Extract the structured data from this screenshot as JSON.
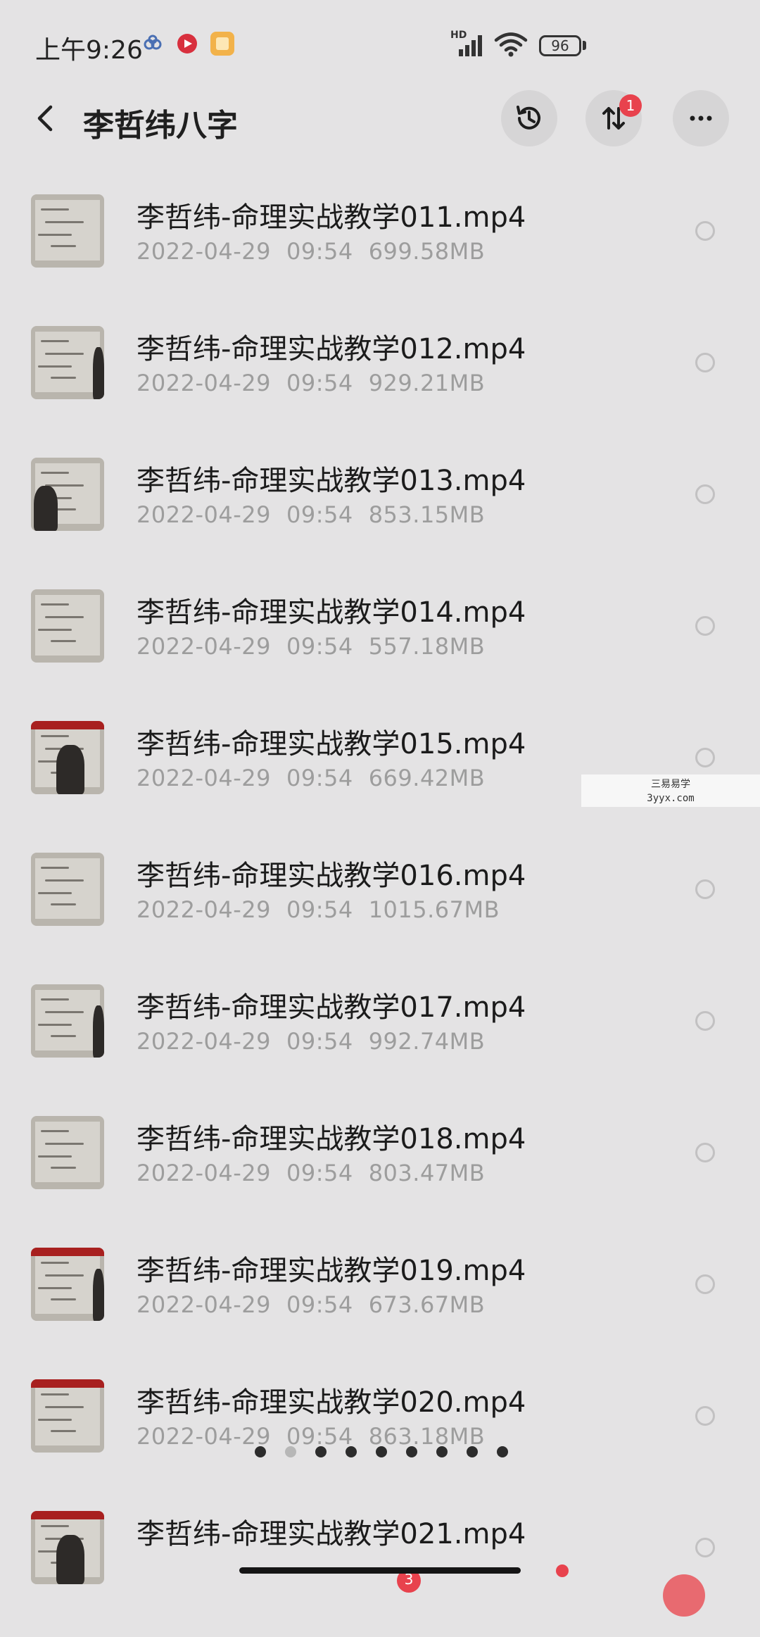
{
  "status_bar": {
    "time": "上午9:26",
    "network_label": "HD",
    "battery": "96"
  },
  "header": {
    "title": "李哲纬八字",
    "transfer_badge": "1"
  },
  "files": [
    {
      "name": "李哲纬-命理实战教学011.mp4",
      "date": "2022-04-29",
      "time": "09:54",
      "size": "699.58MB",
      "thumb": "board"
    },
    {
      "name": "李哲纬-命理实战教学012.mp4",
      "date": "2022-04-29",
      "time": "09:54",
      "size": "929.21MB",
      "thumb": "board-person-right"
    },
    {
      "name": "李哲纬-命理实战教学013.mp4",
      "date": "2022-04-29",
      "time": "09:54",
      "size": "853.15MB",
      "thumb": "person-left"
    },
    {
      "name": "李哲纬-命理实战教学014.mp4",
      "date": "2022-04-29",
      "time": "09:54",
      "size": "557.18MB",
      "thumb": "board"
    },
    {
      "name": "李哲纬-命理实战教学015.mp4",
      "date": "2022-04-29",
      "time": "09:54",
      "size": "669.42MB",
      "thumb": "person-center-red"
    },
    {
      "name": "李哲纬-命理实战教学016.mp4",
      "date": "2022-04-29",
      "time": "09:54",
      "size": "1015.67MB",
      "thumb": "board"
    },
    {
      "name": "李哲纬-命理实战教学017.mp4",
      "date": "2022-04-29",
      "time": "09:54",
      "size": "992.74MB",
      "thumb": "board-person-right"
    },
    {
      "name": "李哲纬-命理实战教学018.mp4",
      "date": "2022-04-29",
      "time": "09:54",
      "size": "803.47MB",
      "thumb": "board"
    },
    {
      "name": "李哲纬-命理实战教学019.mp4",
      "date": "2022-04-29",
      "time": "09:54",
      "size": "673.67MB",
      "thumb": "person-right-red"
    },
    {
      "name": "李哲纬-命理实战教学020.mp4",
      "date": "2022-04-29",
      "time": "09:54",
      "size": "863.18MB",
      "thumb": "board-red"
    },
    {
      "name": "李哲纬-命理实战教学021.mp4",
      "date": "",
      "time": "",
      "size": "",
      "thumb": "person-center-red"
    }
  ],
  "watermark": {
    "line1": "三易易学",
    "line2": "3yyx.com"
  },
  "pager": {
    "count": 9,
    "active_index": 1
  },
  "bottom_bar": {
    "badge": "3"
  },
  "colors": {
    "background": "#e4e3e4",
    "accent_red": "#e8424d",
    "meta_gray": "#9d9d9d"
  }
}
